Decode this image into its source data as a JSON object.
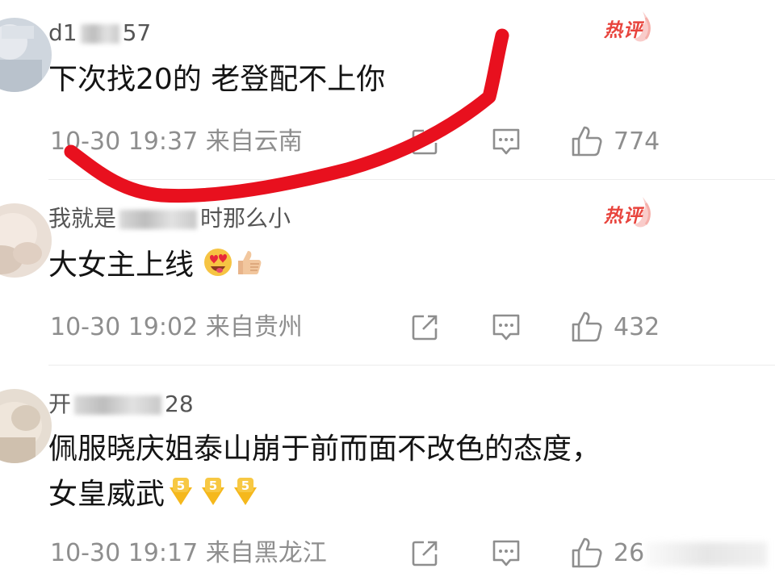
{
  "comments": [
    {
      "username_start": "d1",
      "username_end": "57",
      "hot_label": "热评",
      "text": "下次找20的 老登配不上你",
      "meta": "10-30 19:37 来自云南",
      "likes": "774"
    },
    {
      "username_start": "我就是",
      "username_end": "时那么小",
      "hot_label": "热评",
      "text": "大女主上线",
      "meta": "10-30 19:02 来自贵州",
      "likes": "432"
    },
    {
      "username_start": "开",
      "username_end": "28",
      "text_line1": "佩服晓庆姐泰山崩于前而面不改色的态度，",
      "text_line2": "女皇威武",
      "meta": "10-30 19:17 来自黑龙江",
      "likes": "26"
    }
  ],
  "icons": {
    "share": "share-icon",
    "comment": "comment-icon",
    "like": "thumbs-up-icon",
    "hot": "flame-icon"
  },
  "colors": {
    "hot_badge": "#e8443d",
    "scribble": "#e8101e",
    "meta_text": "#8e8e8e"
  }
}
